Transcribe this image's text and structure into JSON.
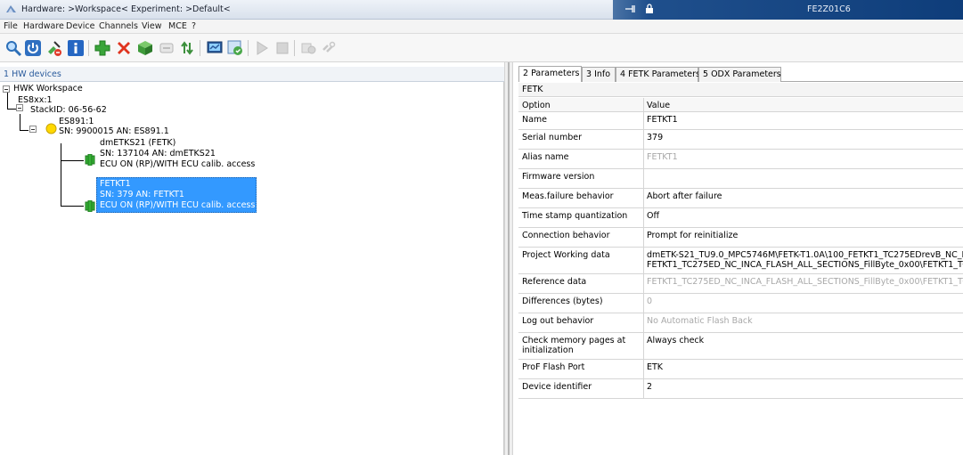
{
  "window": {
    "title": "Hardware: >Workspace<  Experiment: >Default<",
    "device_id": "FE2Z01C6"
  },
  "menu": [
    "File",
    "Hardware",
    "Device",
    "Channels",
    "View",
    "MCE",
    "?"
  ],
  "toolbar": {
    "icons": [
      "search-icon",
      "power-icon",
      "disconnect-icon",
      "info-icon",
      "add-icon",
      "delete-icon",
      "package-icon",
      "device-gray-icon",
      "arrows-updown-icon",
      "monitor-icon",
      "check-target-icon",
      "play-icon",
      "stop-icon",
      "config-gray-icon",
      "link-gray-icon"
    ]
  },
  "left_pane": {
    "header": "1 HW devices",
    "tree": {
      "workspace": "HWK Workspace",
      "es8xx": "ES8xx:1",
      "stack": "StackID: 06-56-62",
      "es891": "ES891:1",
      "es891_sn": "SN: 9900015 AN: ES891.1",
      "dmetks21": "dmETKS21 (FETK)",
      "dmetks21_sn": "SN: 137104 AN: dmETKS21",
      "dmetks21_state": "ECU ON (RP)/WITH ECU calib. access",
      "fetkt1": "FETKT1",
      "fetkt1_sn": "SN: 379 AN: FETKT1",
      "fetkt1_state": "ECU ON (RP)/WITH ECU calib. access"
    }
  },
  "right_pane": {
    "tabs": [
      "2 Parameters",
      "3 Info",
      "4 FETK Parameters",
      "5 ODX Parameters"
    ],
    "section_title": "FETK",
    "columns": {
      "option": "Option",
      "value": "Value"
    },
    "rows": [
      {
        "option": "Name",
        "value": "FETKT1"
      },
      {
        "option": "Serial number",
        "value": "379"
      },
      {
        "option": "Alias name",
        "value": "FETKT1"
      },
      {
        "option": "Firmware version",
        "value": ""
      },
      {
        "option": "Meas.failure behavior",
        "value": "Abort after failure"
      },
      {
        "option": "Time stamp quantization",
        "value": "Off"
      },
      {
        "option": "Connection behavior",
        "value": "Prompt for reinitialize"
      },
      {
        "option": "Project",
        "option2": "Working data",
        "value": "dmETK-S21_TU9.0_MPC5746M\\FETK-T1.0A\\100_FETKT1_TC275EDrevB_NC_I",
        "value2": "FETKT1_TC275ED_NC_INCA_FLASH_ALL_SECTIONS_FillByte_0x00\\FETKT1_TC"
      },
      {
        "option": "Reference data",
        "value": "FETKT1_TC275ED_NC_INCA_FLASH_ALL_SECTIONS_FillByte_0x00\\FETKT1_TC"
      },
      {
        "option": "Differences (bytes)",
        "value": "0"
      },
      {
        "option": "Log out behavior",
        "value": "No Automatic Flash Back"
      },
      {
        "option": "Check memory pages",
        "option2": "at initialization",
        "value": "Always check"
      },
      {
        "option": "ProF Flash Port",
        "value": "ETK"
      },
      {
        "option": "Device identifier",
        "value": "2"
      }
    ]
  },
  "colors": {
    "selection": "#3399ff",
    "title_dark": "#0e3d7a",
    "header_text": "#2a5b9c",
    "disabled_text": "#a8a8a8"
  }
}
